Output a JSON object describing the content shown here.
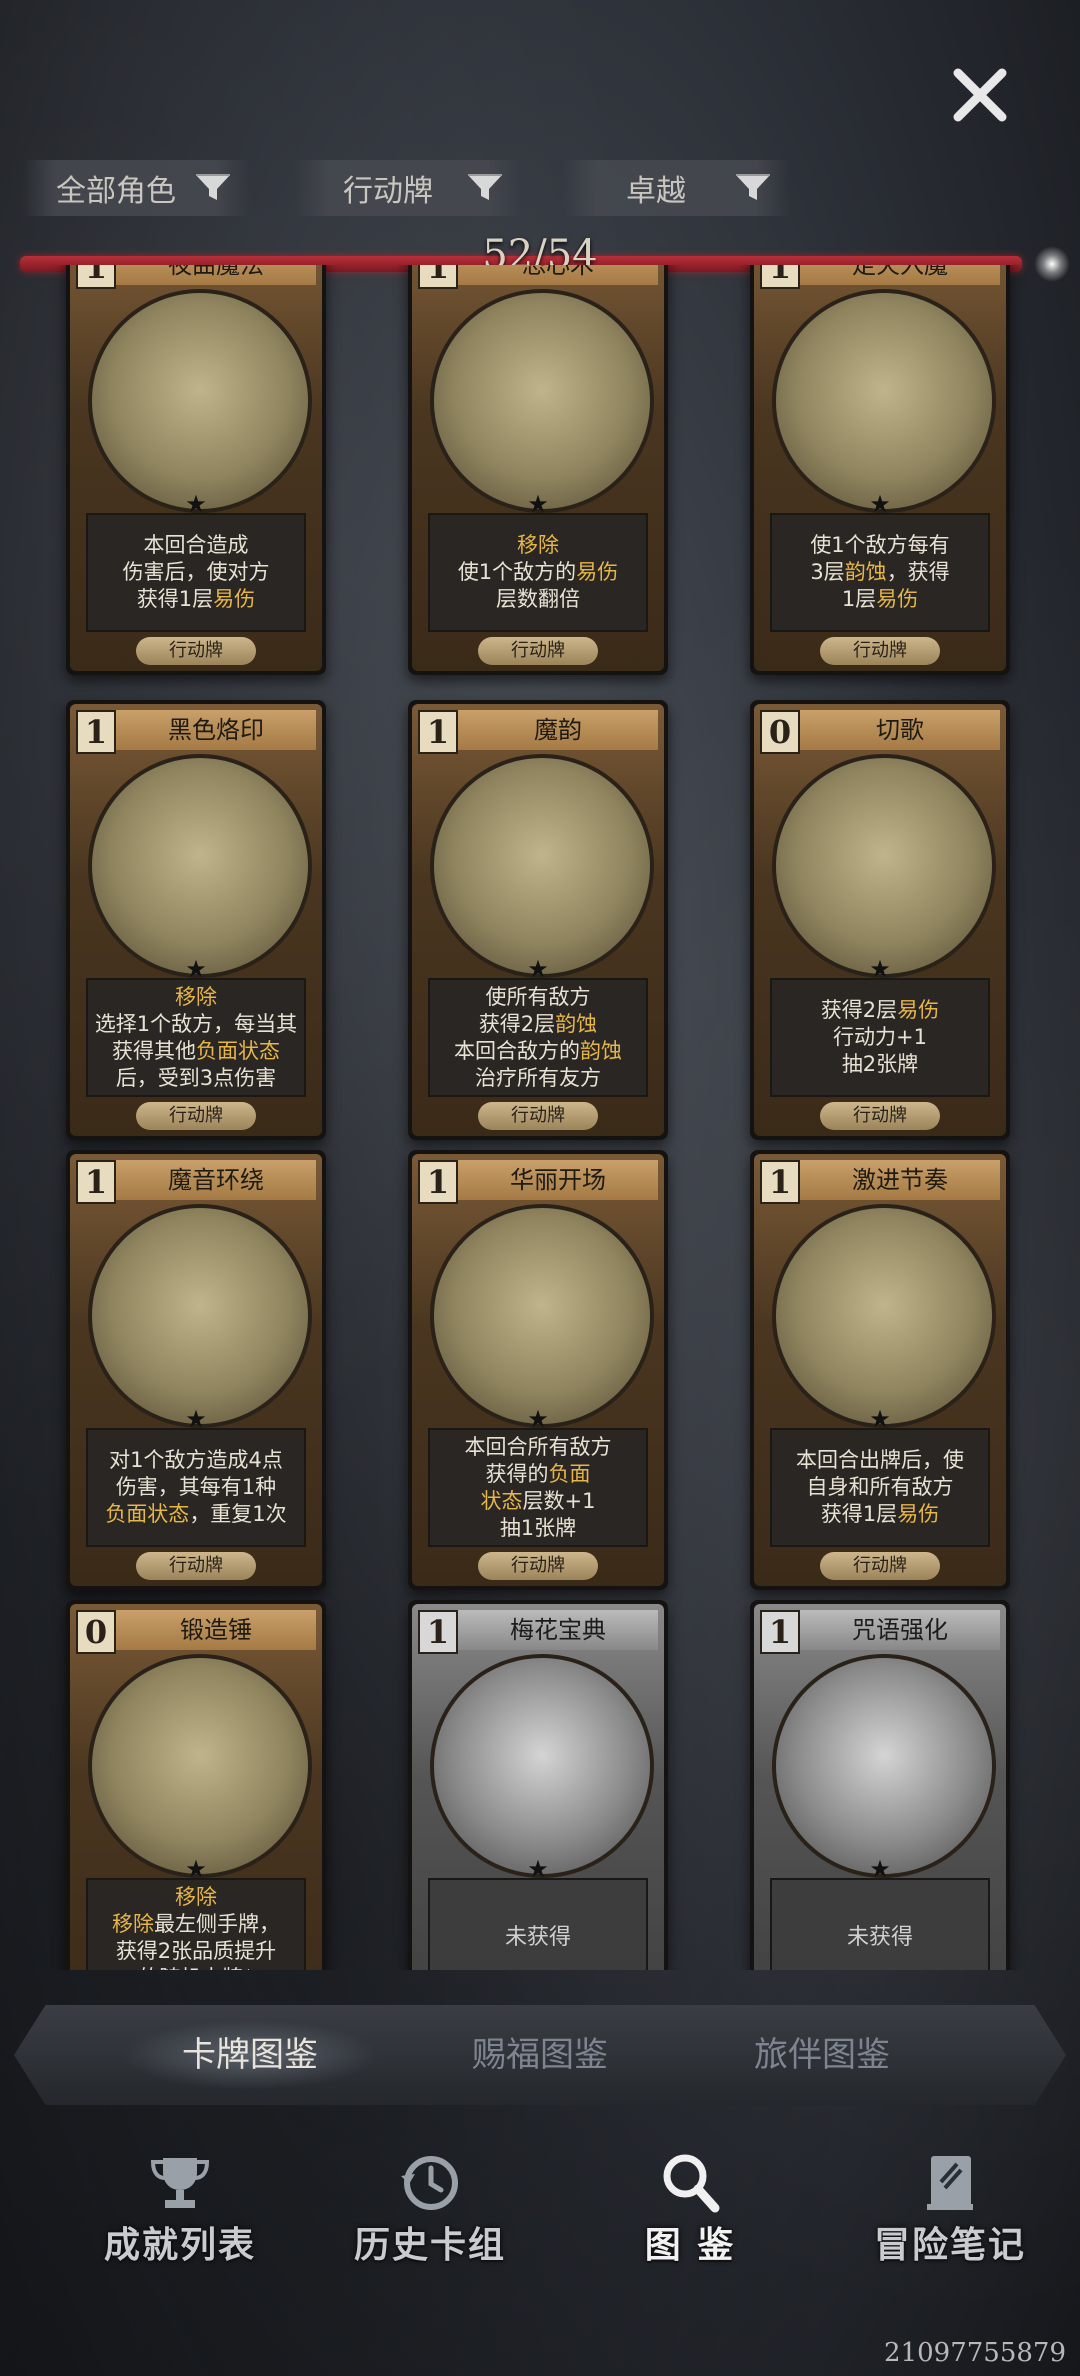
{
  "filters": [
    {
      "label": "全部角色"
    },
    {
      "label": "行动牌"
    },
    {
      "label": "卓越"
    }
  ],
  "progress": {
    "count": "52/54",
    "fraction": 0.963
  },
  "cards": [
    {
      "cost": "1",
      "name": "夜曲魔法",
      "desc": [
        [
          {
            "t": "本回合造成"
          }
        ],
        [
          {
            "t": "伤害后，使对方"
          }
        ],
        [
          {
            "t": "获得1层"
          },
          {
            "t": "易伤",
            "h": true
          }
        ]
      ],
      "type": "行动牌",
      "locked": false
    },
    {
      "cost": "1",
      "name": "恐心术",
      "desc": [
        [
          {
            "t": "移除",
            "h": true
          }
        ],
        [
          {
            "t": "使1个敌方的"
          },
          {
            "t": "易伤",
            "h": true
          }
        ],
        [
          {
            "t": "层数翻倍"
          }
        ]
      ],
      "type": "行动牌",
      "locked": false
    },
    {
      "cost": "1",
      "name": "走火入魔",
      "desc": [
        [
          {
            "t": "使1个敌方每有"
          }
        ],
        [
          {
            "t": "3层"
          },
          {
            "t": "韵蚀",
            "h": true
          },
          {
            "t": "，获得"
          }
        ],
        [
          {
            "t": "1层"
          },
          {
            "t": "易伤",
            "h": true
          }
        ]
      ],
      "type": "行动牌",
      "locked": false
    },
    {
      "cost": "1",
      "name": "黑色烙印",
      "desc": [
        [
          {
            "t": "移除",
            "h": true
          }
        ],
        [
          {
            "t": "选择1个敌方，每当其"
          }
        ],
        [
          {
            "t": "获得其他"
          },
          {
            "t": "负面状态",
            "h": true
          }
        ],
        [
          {
            "t": "后，受到3点伤害"
          }
        ]
      ],
      "type": "行动牌",
      "locked": false
    },
    {
      "cost": "1",
      "name": "魔韵",
      "desc": [
        [
          {
            "t": "使所有敌方"
          }
        ],
        [
          {
            "t": "获得2层"
          },
          {
            "t": "韵蚀",
            "h": true
          }
        ],
        [
          {
            "t": "本回合敌方的"
          },
          {
            "t": "韵蚀",
            "h": true
          }
        ],
        [
          {
            "t": "治疗所有友方"
          }
        ]
      ],
      "type": "行动牌",
      "locked": false
    },
    {
      "cost": "0",
      "name": "切歌",
      "desc": [
        [
          {
            "t": "获得2层"
          },
          {
            "t": "易伤",
            "h": true
          }
        ],
        [
          {
            "t": "行动力+1"
          }
        ],
        [
          {
            "t": "抽2张牌"
          }
        ]
      ],
      "type": "行动牌",
      "locked": false
    },
    {
      "cost": "1",
      "name": "魔音环绕",
      "desc": [
        [
          {
            "t": "对1个敌方造成4点"
          }
        ],
        [
          {
            "t": "伤害，其每有1种"
          }
        ],
        [
          {
            "t": "负面状态",
            "h": true
          },
          {
            "t": "，重复1次"
          }
        ]
      ],
      "type": "行动牌",
      "locked": false
    },
    {
      "cost": "1",
      "name": "华丽开场",
      "desc": [
        [
          {
            "t": "本回合所有敌方"
          }
        ],
        [
          {
            "t": "获得的"
          },
          {
            "t": "负面",
            "h": true
          }
        ],
        [
          {
            "t": "状态",
            "h": true
          },
          {
            "t": "层数+1"
          }
        ],
        [
          {
            "t": "抽1张牌"
          }
        ]
      ],
      "type": "行动牌",
      "locked": false
    },
    {
      "cost": "1",
      "name": "激进节奏",
      "desc": [
        [
          {
            "t": "本回合出牌后，使"
          }
        ],
        [
          {
            "t": "自身和所有敌方"
          }
        ],
        [
          {
            "t": "获得1层"
          },
          {
            "t": "易伤",
            "h": true
          }
        ]
      ],
      "type": "行动牌",
      "locked": false
    },
    {
      "cost": "0",
      "name": "锻造锤",
      "desc": [
        [
          {
            "t": "移除",
            "h": true
          }
        ],
        [
          {
            "t": "移除",
            "h": true
          },
          {
            "t": "最左侧手牌，"
          }
        ],
        [
          {
            "t": "获得2张品质提升"
          }
        ],
        [
          {
            "t": "的随机卡牌*"
          }
        ]
      ],
      "type": "",
      "locked": false
    },
    {
      "cost": "1",
      "name": "梅花宝典",
      "desc": [
        [
          {
            "t": "未获得"
          }
        ]
      ],
      "type": "",
      "locked": true
    },
    {
      "cost": "1",
      "name": "咒语强化",
      "desc": [
        [
          {
            "t": "未获得"
          }
        ]
      ],
      "type": "",
      "locked": true
    }
  ],
  "tabs": [
    {
      "label": "卡牌图鉴",
      "active": true
    },
    {
      "label": "赐福图鉴",
      "active": false
    },
    {
      "label": "旅伴图鉴",
      "active": false
    }
  ],
  "nav": [
    {
      "label": "成就列表",
      "icon": "trophy-icon"
    },
    {
      "label": "历史卡组",
      "icon": "history-icon"
    },
    {
      "label": "图 鉴",
      "icon": "magnifier-icon",
      "active": true
    },
    {
      "label": "冒险笔记",
      "icon": "notebook-icon"
    }
  ],
  "watermark": "21097755879",
  "colors": {
    "highlight": "#e6b649",
    "progress": "#b9303a"
  }
}
